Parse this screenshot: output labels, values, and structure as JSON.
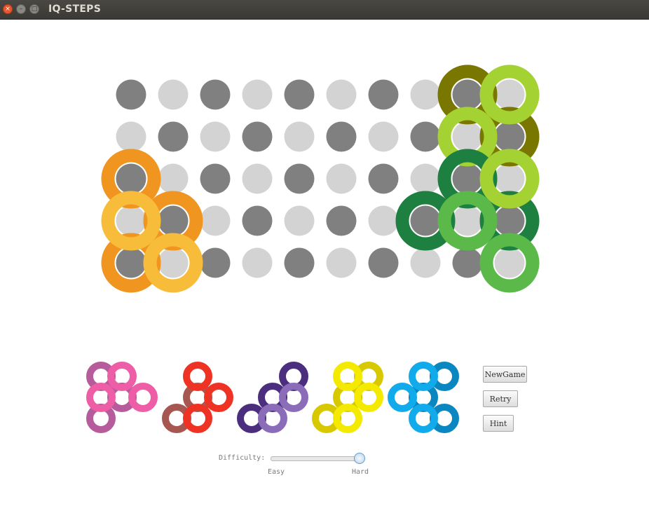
{
  "window": {
    "title": "IQ-STEPS"
  },
  "colors": {
    "peg_dark": "#808080",
    "peg_light": "#d3d3d3",
    "orange": "#f0951f",
    "yellow_orange": "#f8bc3b",
    "olive": "#7a7700",
    "lime": "#a5d233",
    "dark_green": "#1d8040",
    "green": "#5bb94a",
    "magenta_dark": "#b65b9b",
    "pink": "#ee5ea7",
    "red": "#ee3324",
    "brown_red": "#a6574f",
    "purple_dark": "#4b2e7e",
    "purple_light": "#8b6cb8",
    "yellow": "#f4ea00",
    "mustard": "#d7c800",
    "blue": "#11aaea",
    "blue_dark": "#0a86c0"
  },
  "board": {
    "columns": 10,
    "rows": 5
  },
  "placed_pieces": [
    "orange/yellow-orange",
    "olive/lime",
    "dark-green/green"
  ],
  "tray_pieces": [
    "magenta/pink",
    "red/brown",
    "purple",
    "yellow/mustard",
    "blue"
  ],
  "controls": {
    "new_game": "NewGame",
    "retry": "Retry",
    "hint": "Hint"
  },
  "difficulty": {
    "label": "Difficulty:",
    "min_label": "Easy",
    "max_label": "Hard",
    "level": 1.0
  }
}
